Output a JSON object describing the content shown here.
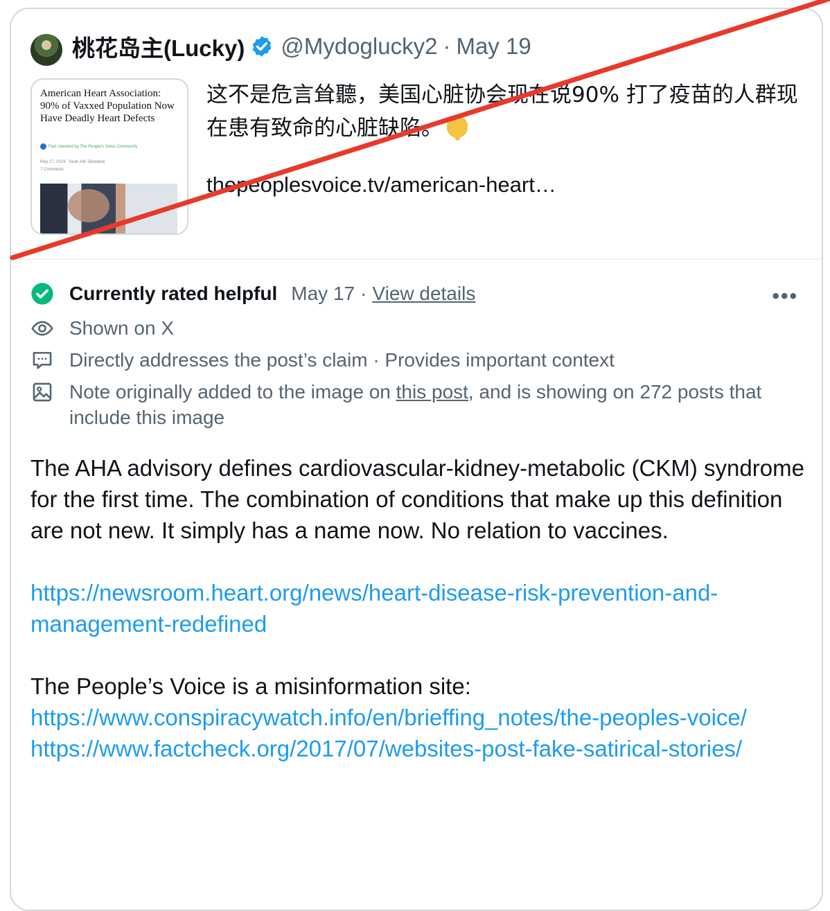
{
  "post": {
    "author": "桃花岛主(Lucky)",
    "handle": "@Mydoglucky2",
    "separator": "·",
    "date": "May 19",
    "text": "这不是危言耸聽，美国心脏协会现在说90% 打了疫苗的人群现在患有致命的心脏缺陷。",
    "link": "thepeoplesvoice.tv/american-heart…",
    "preview": {
      "headline": "American Heart Association: 90% of Vaxxed Population Now Have Deadly Heart Defects",
      "fact_check": "Fact checked by The People's Voice Community",
      "meta_date": "May 17, 2024",
      "meta_author": "Sean Adl-Tabatabai",
      "meta_comments": "7 Comments"
    }
  },
  "note": {
    "status": "Currently rated helpful",
    "date": "May 17",
    "separator": "·",
    "view_details": "View details",
    "more": "•••",
    "shown_on": "Shown on X",
    "tags": "Directly addresses the post’s claim · Provides important context",
    "image_note_prefix": "Note originally added to the image on ",
    "image_note_link": "this post",
    "image_note_suffix": ", and is showing on 272 posts that include this image",
    "paragraph1": "The AHA advisory defines cardiovascular-kidney-metabolic (CKM) syndrome for the first time. The combination of conditions that make up this definition are not new. It simply has a name now. No relation to vaccines.",
    "link1": "https://newsroom.heart.org/news/heart-disease-risk-prevention-and-management-redefined",
    "paragraph2": "The People’s Voice is a misinformation site:",
    "link2": "https://www.conspiracywatch.info/en/brieffing_notes/the-peoples-voice/",
    "link3": "https://www.factcheck.org/2017/07/websites-post-fake-satirical-stories/"
  },
  "colors": {
    "text": "#0f1419",
    "secondary": "#536471",
    "link": "#1d9bf0",
    "verified": "#1d9bf0",
    "helpful": "#00ba7c",
    "slash": "#e8392a"
  }
}
